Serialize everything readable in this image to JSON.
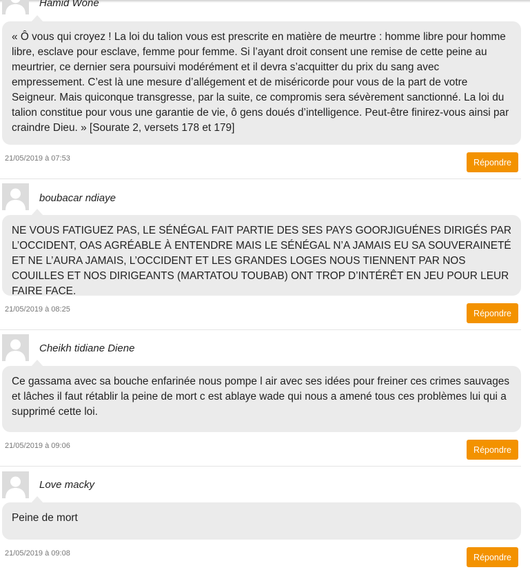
{
  "comments": [
    {
      "author": "Hamid Wone",
      "text": "« Ô vous qui croyez ! La loi du talion vous est prescrite en matière de meurtre : homme libre pour homme libre, esclave pour esclave, femme pour femme. Si l’ayant droit consent une remise de cette peine au meurtrier, ce dernier sera poursuivi modérément et il devra s’acquitter du prix du sang avec empressement. C’est là une mesure d’allégement et de miséricorde pour vous de la part de votre Seigneur. Mais quiconque transgresse, par la suite, ce compromis sera sévèrement sanctionné. La loi du talion constitue pour vous une garantie de vie, ô gens doués d’intelligence. Peut-être finirez-vous ainsi par craindre Dieu. » [Sourate 2, versets 178 et 179]",
      "date": "21/05/2019 à 07:53",
      "reply_label": "Répondre"
    },
    {
      "author": "boubacar ndiaye",
      "text": "NE VOUS FATIGUEZ PAS, LE SÉNÉGAL FAIT PARTIE DES SES PAYS GOORJIGUÉNES DIRIGÉS PAR L’OCCIDENT, OAS AGRÉABLE À ENTENDRE MAIS LE SÉNÉGAL N’A JAMAIS EU SA SOUVERAINETÉ ET NE L’AURA JAMAIS, L’OCCIDENT ET LES GRANDES LOGES NOUS TIENNENT PAR NOS COUILLES ET NOS DIRIGEANTS (MARTATOU TOUBAB) ONT TROP D’INTÉRÊT EN JEU POUR LEUR FAIRE FACE.",
      "date": "21/05/2019 à 08:25",
      "reply_label": "Répondre"
    },
    {
      "author": "Cheikh tidiane Diene",
      "text": "Ce gassama avec sa bouche enfarinée nous pompe l air avec ses idées pour freiner ces crimes sauvages et lâches il faut rétablir la peine de mort c est ablaye wade qui nous a amené tous ces problèmes lui qui a supprimé cette loi.",
      "date": "21/05/2019 à 09:06",
      "reply_label": "Répondre"
    },
    {
      "author": "Love macky",
      "text": "Peine de mort",
      "date": "21/05/2019 à 09:08",
      "reply_label": "Répondre"
    }
  ],
  "colors": {
    "reply_button": "#f39200",
    "bubble": "#ebebeb",
    "avatar": "#dcdcdc"
  }
}
